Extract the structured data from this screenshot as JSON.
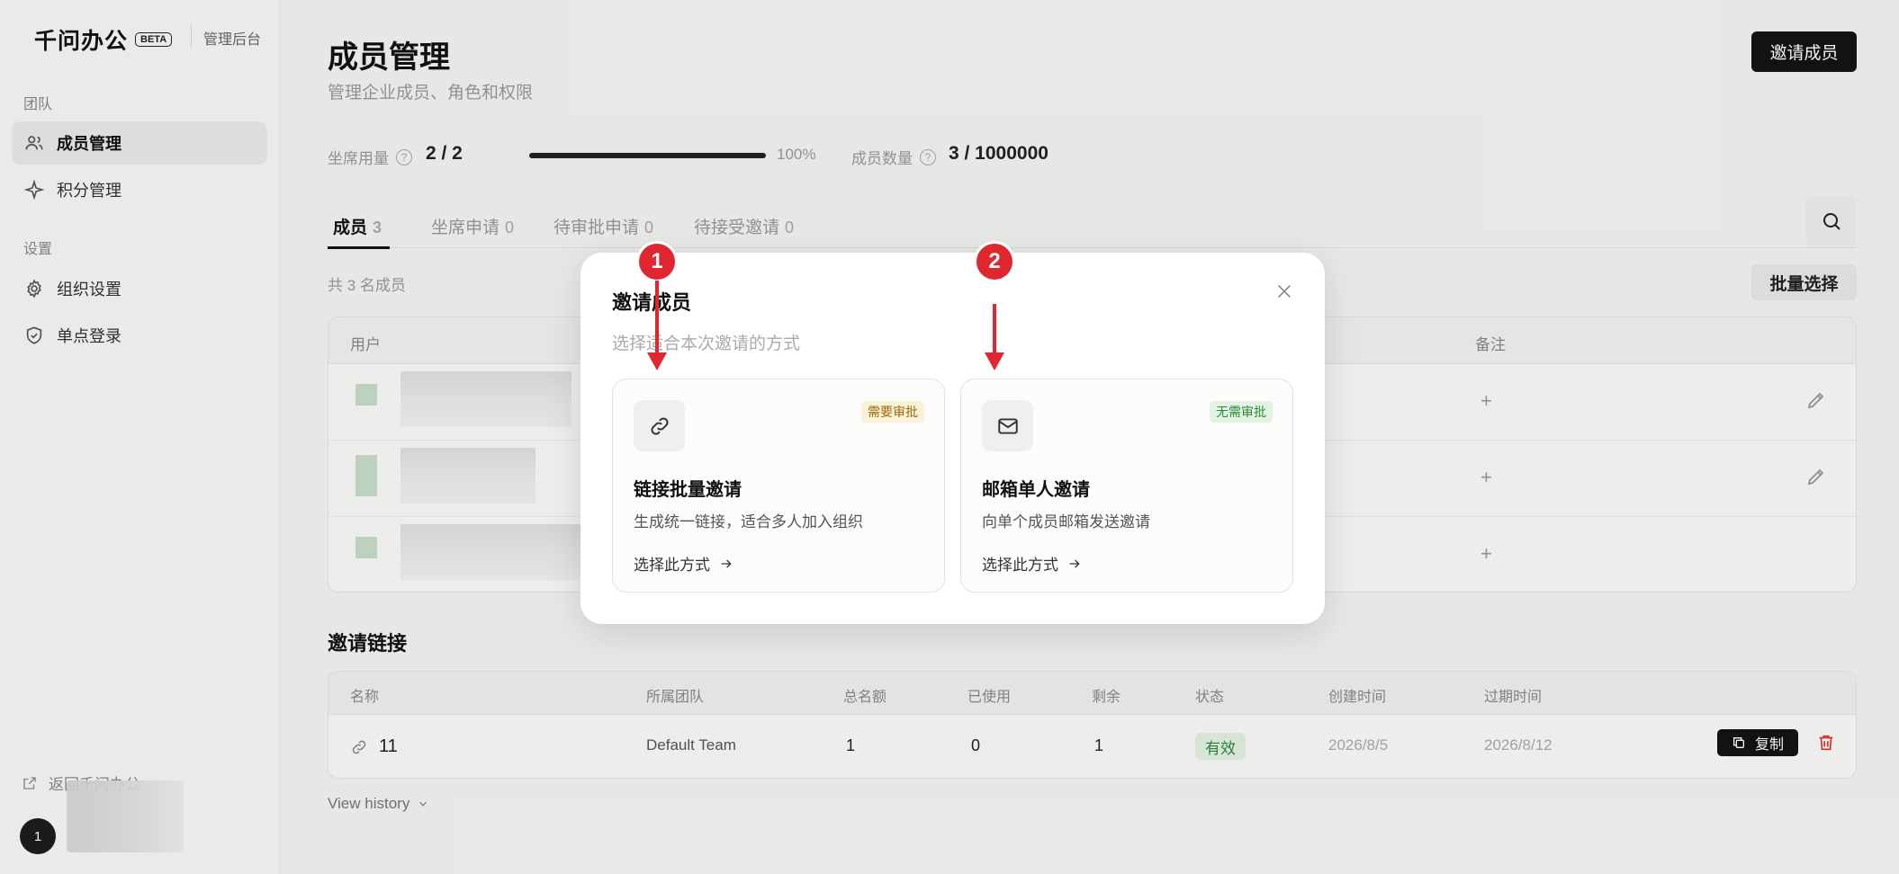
{
  "sidebar": {
    "brand": "千问办公",
    "beta": "BETA",
    "subtitle": "管理后台",
    "section_team": "团队",
    "section_settings": "设置",
    "items": [
      {
        "label": "成员管理",
        "icon": "users-icon",
        "active": true
      },
      {
        "label": "积分管理",
        "icon": "sparkle-icon",
        "active": false
      },
      {
        "label": "组织设置",
        "icon": "gear-icon",
        "active": false
      },
      {
        "label": "单点登录",
        "icon": "shield-icon",
        "active": false
      }
    ],
    "back_label": "返回千问办公",
    "avatar_text": "1"
  },
  "header": {
    "title": "成员管理",
    "subtitle": "管理企业成员、角色和权限",
    "invite_button": "邀请成员"
  },
  "stats": {
    "seats_label": "坐席用量",
    "seats_value": "2 / 2",
    "seats_fraction": 1.0,
    "seats_percent": "100%",
    "members_label": "成员数量",
    "members_value": "3 / 1000000",
    "help_glyph": "?"
  },
  "tabs": [
    {
      "label": "成员",
      "count": "3",
      "active": true
    },
    {
      "label": "坐席申请",
      "count": "0",
      "active": false
    },
    {
      "label": "待审批申请",
      "count": "0",
      "active": false
    },
    {
      "label": "待接受邀请",
      "count": "0",
      "active": false
    }
  ],
  "members": {
    "count_text": "共 3 名成员",
    "batch_button": "批量选择",
    "columns": {
      "user": "用户",
      "note": "备注"
    },
    "add_note_glyph": "+"
  },
  "invite_links": {
    "title": "邀请链接",
    "columns": [
      "名称",
      "所属团队",
      "总名额",
      "已使用",
      "剩余",
      "状态",
      "创建时间",
      "过期时间"
    ],
    "row": {
      "name": "11",
      "team": "Default Team",
      "total": "1",
      "used": "0",
      "remaining": "1",
      "status": "有效",
      "created": "2026/8/5",
      "expires": "2026/8/12",
      "copy_label": "复制"
    },
    "history_label": "View history"
  },
  "modal": {
    "title": "邀请成员",
    "subtitle": "选择适合本次邀请的方式",
    "options": [
      {
        "icon": "link-icon",
        "badge": "需要审批",
        "title": "链接批量邀请",
        "desc": "生成统一链接，适合多人加入组织",
        "action": "选择此方式"
      },
      {
        "icon": "mail-icon",
        "badge": "无需审批",
        "title": "邮箱单人邀请",
        "desc": "向单个成员邮箱发送邀请",
        "action": "选择此方式"
      }
    ]
  },
  "annotations": {
    "marker_1": "1",
    "marker_2": "2",
    "color": "#e0262e"
  }
}
